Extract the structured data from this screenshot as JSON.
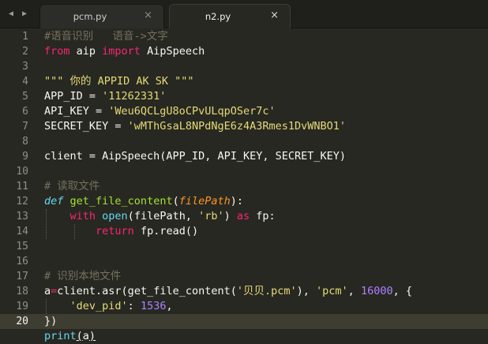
{
  "tabs": [
    {
      "label": "pcm.py",
      "close": "×",
      "active": false
    },
    {
      "label": "n2.py",
      "close": "×",
      "active": true
    }
  ],
  "nav": {
    "left": "◀",
    "right": "▶"
  },
  "current_line": 20,
  "line_numbers": [
    "1",
    "2",
    "3",
    "4",
    "5",
    "6",
    "7",
    "8",
    "9",
    "10",
    "11",
    "12",
    "13",
    "14",
    "15",
    "16",
    "17",
    "18",
    "19",
    "20"
  ],
  "code": {
    "l1": {
      "comment": "#语音识别   语音->文字"
    },
    "l2": {
      "kw_from": "from",
      "mod": " aip ",
      "kw_import": "import",
      "name": " AipSpeech"
    },
    "l4": {
      "doc": "\"\"\" 你的 APPID AK SK \"\"\""
    },
    "l5": {
      "var": "APP_ID = ",
      "str": "'11262331'"
    },
    "l6": {
      "var": "API_KEY = ",
      "str": "'Weu6QCLgU8oCPvULqpOSer7c'"
    },
    "l7": {
      "var": "SECRET_KEY = ",
      "str": "'wMThGsaL8NPdNgE6z4A3Rmes1DvWNBO1'"
    },
    "l9": {
      "text": "client = AipSpeech(APP_ID, API_KEY, SECRET_KEY)"
    },
    "l11": {
      "comment": "# 读取文件"
    },
    "l12": {
      "kw_def": "def",
      "fname": "get_file_content",
      "open": "(",
      "param": "filePath",
      "close": "):"
    },
    "l13": {
      "kw_with": "with",
      "builtin": "open",
      "args1": "(filePath, ",
      "str": "'rb'",
      "args2": ") ",
      "kw_as": "as",
      "tail": " fp:"
    },
    "l14": {
      "kw_return": "return",
      "tail": " fp.read()"
    },
    "l16": {
      "comment": "# 识别本地文件"
    },
    "l17": {
      "a": "a",
      "eq": "=",
      "call": "client.asr(get_file_content(",
      "s1": "'贝贝.pcm'",
      "mid": "), ",
      "s2": "'pcm'",
      "comma": ", ",
      "num": "16000",
      "tail": ", {"
    },
    "l18": {
      "key": "'dev_pid'",
      "colon": ": ",
      "num": "1536",
      "tail": ","
    },
    "l19": {
      "text": "})"
    },
    "l20": {
      "builtin": "print",
      "open": "(",
      "arg": "a",
      "close": ")"
    }
  }
}
